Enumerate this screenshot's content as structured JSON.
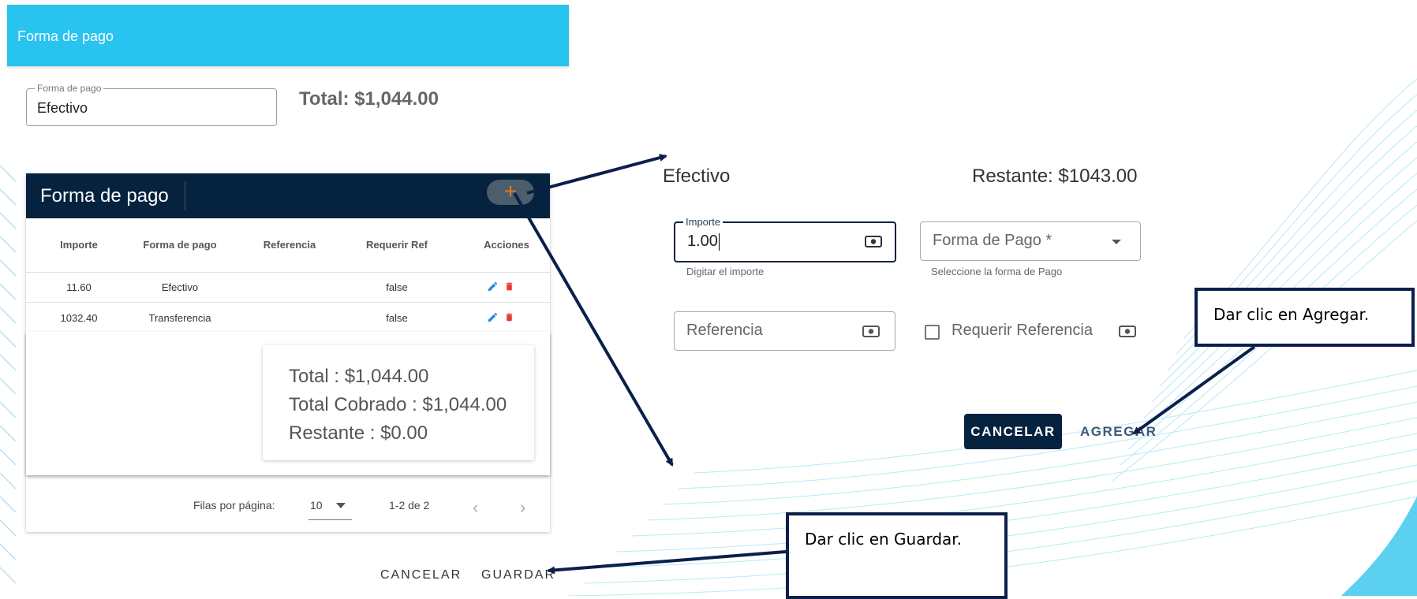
{
  "dialog": {
    "title": "Forma de pago",
    "payment_field": {
      "label": "Forma de pago",
      "value": "Efectivo"
    },
    "total_header": "Total: $1,044.00",
    "table": {
      "title": "Forma de pago",
      "add_icon": "plus-icon",
      "columns": [
        "Importe",
        "Forma de pago",
        "Referencia",
        "Requerir Ref",
        "Acciones"
      ],
      "rows": [
        {
          "importe": "11.60",
          "forma": "Efectivo",
          "referencia": "",
          "requerir": "false"
        },
        {
          "importe": "1032.40",
          "forma": "Transferencia",
          "referencia": "",
          "requerir": "false"
        }
      ],
      "summary": {
        "total": "Total : $1,044.00",
        "cobrado": "Total Cobrado : $1,044.00",
        "restante": "Restante : $0.00"
      },
      "pager": {
        "rows_label": "Filas por página:",
        "rows_value": "10",
        "range": "1-2 de 2"
      }
    },
    "cancel_label": "CANCELAR",
    "save_label": "GUARDAR"
  },
  "form": {
    "heading": "Efectivo",
    "remaining": "Restante: $1043.00",
    "importe": {
      "label": "Importe",
      "value": "1.00",
      "helper": "Digitar el importe"
    },
    "forma_pago": {
      "placeholder": "Forma de Pago *",
      "helper": "Seleccione la forma de Pago"
    },
    "referencia": {
      "placeholder": "Referencia"
    },
    "requerir_ref": {
      "label": "Requerir Referencia",
      "checked": false
    },
    "cancel_label": "CANCELAR",
    "add_label": "AGREGAR"
  },
  "callouts": {
    "agregar": "Dar clic en Agregar.",
    "guardar": "Dar clic en Guardar."
  },
  "colors": {
    "header_blue": "#29c3ef",
    "navy": "#05223f",
    "edit_blue": "#1e88e5",
    "delete_red": "#e53935",
    "arrow_navy": "#0b1f4b"
  }
}
